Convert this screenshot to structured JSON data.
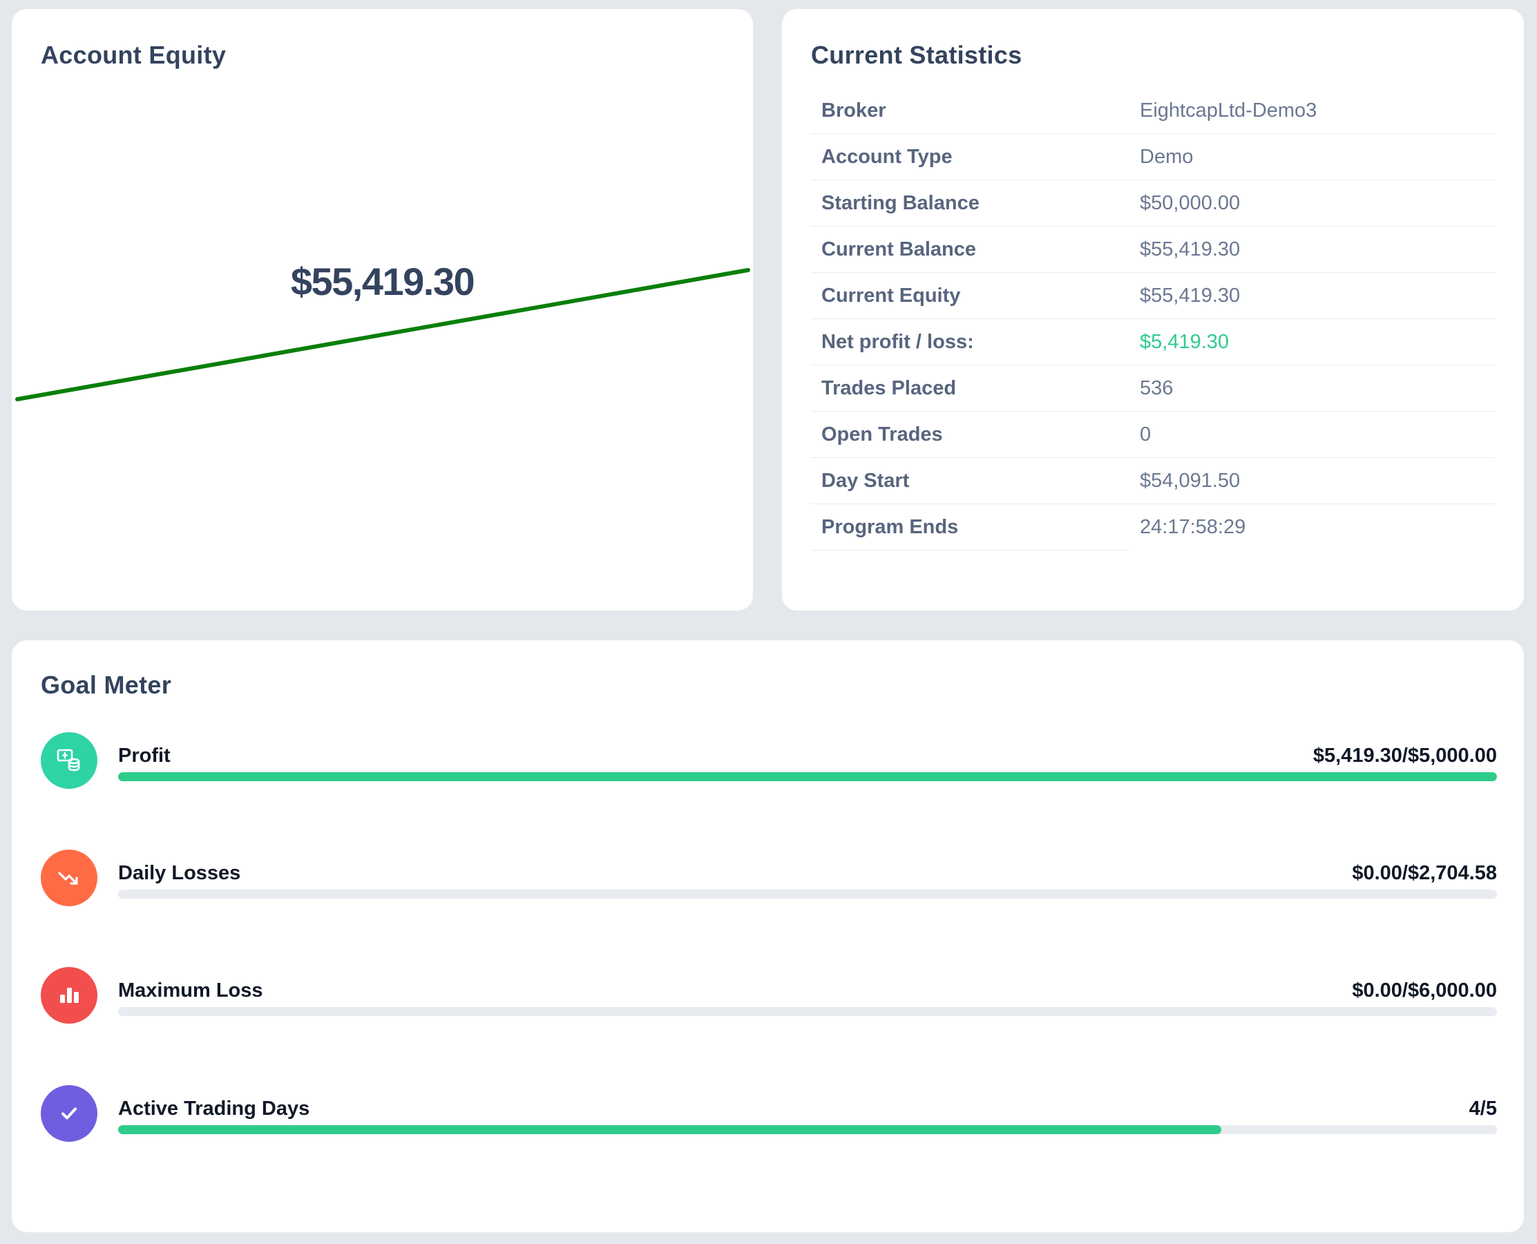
{
  "equity": {
    "title": "Account Equity",
    "value": "$55,419.30",
    "line_color": "#0a7f0a"
  },
  "stats": {
    "title": "Current Statistics",
    "rows": [
      {
        "label": "Broker",
        "value": "EightcapLtd-Demo3"
      },
      {
        "label": "Account Type",
        "value": "Demo"
      },
      {
        "label": "Starting Balance",
        "value": "$50,000.00"
      },
      {
        "label": "Current Balance",
        "value": "$55,419.30"
      },
      {
        "label": "Current Equity",
        "value": "$55,419.30"
      },
      {
        "label": "Net profit / loss:",
        "value": "$5,419.30"
      },
      {
        "label": "Trades Placed",
        "value": "536"
      },
      {
        "label": "Open Trades",
        "value": "0"
      },
      {
        "label": "Day Start",
        "value": "$54,091.50"
      },
      {
        "label": "Program Ends",
        "value": "24:17:58:29"
      }
    ],
    "positive_color": "#2fcb8e"
  },
  "goal": {
    "title": "Goal Meter",
    "items": [
      {
        "label": "Profit",
        "value": "$5,419.30/$5,000.00",
        "progress": 1.0,
        "icon": "money-stack-icon",
        "icon_color": "#2ed3a6"
      },
      {
        "label": "Daily Losses",
        "value": "$0.00/$2,704.58",
        "progress": 0.0,
        "icon": "trending-down-icon",
        "icon_color": "#ff6b45"
      },
      {
        "label": "Maximum Loss",
        "value": "$0.00/$6,000.00",
        "progress": 0.0,
        "icon": "bar-chart-icon",
        "icon_color": "#f24e4e"
      },
      {
        "label": "Active Trading Days",
        "value": "4/5",
        "progress": 0.8,
        "icon": "check-icon",
        "icon_color": "#6f5fe0"
      }
    ],
    "bar_color": "#2ecc8a"
  }
}
